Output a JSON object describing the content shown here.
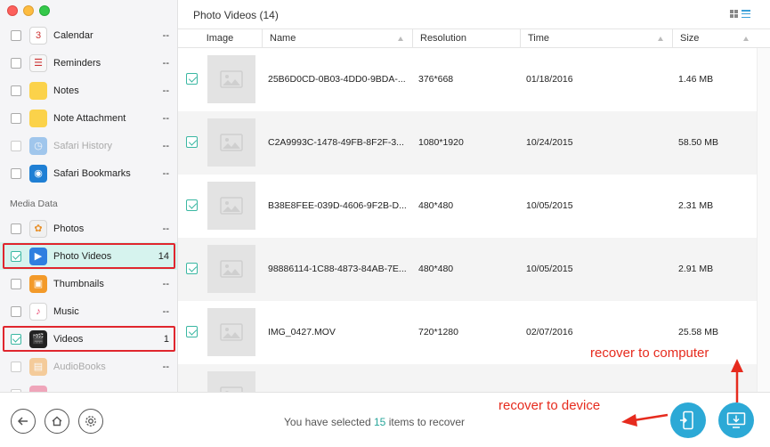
{
  "window": {
    "title": "Photo Videos (14)"
  },
  "sidebar": {
    "section_media": "Media Data",
    "items": [
      {
        "label": "Calendar",
        "count": "--",
        "icon": "calendar-icon",
        "glyph": "3",
        "color": "#ffffff",
        "checked": false,
        "disabled": false,
        "selected": false,
        "highlight": false
      },
      {
        "label": "Reminders",
        "count": "--",
        "icon": "reminders-icon",
        "glyph": "☰",
        "color": "#f7f7f7",
        "checked": false,
        "disabled": false,
        "selected": false,
        "highlight": false
      },
      {
        "label": "Notes",
        "count": "--",
        "icon": "notes-icon",
        "glyph": "",
        "color": "#fbd24a",
        "checked": false,
        "disabled": false,
        "selected": false,
        "highlight": false
      },
      {
        "label": "Note Attachment",
        "count": "--",
        "icon": "note-attachment-icon",
        "glyph": "",
        "color": "#fbd24a",
        "checked": false,
        "disabled": false,
        "selected": false,
        "highlight": false
      },
      {
        "label": "Safari History",
        "count": "--",
        "icon": "safari-history-icon",
        "glyph": "◷",
        "color": "#3b8fe0",
        "checked": false,
        "disabled": true,
        "selected": false,
        "highlight": false
      },
      {
        "label": "Safari Bookmarks",
        "count": "--",
        "icon": "safari-bookmarks-icon",
        "glyph": "◉",
        "color": "#1f7fd4",
        "checked": false,
        "disabled": false,
        "selected": false,
        "highlight": false
      },
      {
        "label": "Photos",
        "count": "--",
        "icon": "photos-icon",
        "glyph": "✿",
        "color": "#f0f0f0",
        "checked": false,
        "disabled": false,
        "selected": false,
        "highlight": false
      },
      {
        "label": "Photo Videos",
        "count": "14",
        "icon": "photo-videos-icon",
        "glyph": "▶",
        "color": "#2f7fe0",
        "checked": true,
        "disabled": false,
        "selected": true,
        "highlight": true
      },
      {
        "label": "Thumbnails",
        "count": "--",
        "icon": "thumbnails-icon",
        "glyph": "▣",
        "color": "#f39a2a",
        "checked": false,
        "disabled": false,
        "selected": false,
        "highlight": false
      },
      {
        "label": "Music",
        "count": "--",
        "icon": "music-icon",
        "glyph": "♪",
        "color": "#ffffff",
        "checked": false,
        "disabled": false,
        "selected": false,
        "highlight": false
      },
      {
        "label": "Videos",
        "count": "1",
        "icon": "videos-icon",
        "glyph": "🎬",
        "color": "#222222",
        "checked": true,
        "disabled": false,
        "selected": false,
        "highlight": true
      },
      {
        "label": "AudioBooks",
        "count": "--",
        "icon": "audiobooks-icon",
        "glyph": "▤",
        "color": "#f39a2a",
        "checked": false,
        "disabled": true,
        "selected": false,
        "highlight": false
      },
      {
        "label": "",
        "count": "",
        "icon": "books-icon",
        "glyph": "",
        "color": "#e8446e",
        "checked": false,
        "disabled": true,
        "selected": false,
        "highlight": false
      }
    ]
  },
  "table": {
    "columns": [
      "Image",
      "Name",
      "Resolution",
      "Time",
      "Size"
    ],
    "rows": [
      {
        "name": "25B6D0CD-0B03-4DD0-9BDA-...",
        "resolution": "376*668",
        "time": "01/18/2016",
        "size": "1.46 MB"
      },
      {
        "name": "C2A9993C-1478-49FB-8F2F-3...",
        "resolution": "1080*1920",
        "time": "10/24/2015",
        "size": "58.50 MB"
      },
      {
        "name": "B38E8FEE-039D-4606-9F2B-D...",
        "resolution": "480*480",
        "time": "10/05/2015",
        "size": "2.31 MB"
      },
      {
        "name": "98886114-1C88-4873-84AB-7E...",
        "resolution": "480*480",
        "time": "10/05/2015",
        "size": "2.91 MB"
      },
      {
        "name": "IMG_0427.MOV",
        "resolution": "720*1280",
        "time": "02/07/2016",
        "size": "25.58 MB"
      },
      {
        "name": "",
        "resolution": "",
        "time": "",
        "size": ""
      }
    ]
  },
  "footer": {
    "status_prefix": "You have selected",
    "selected_count": "15",
    "status_suffix": "items to recover"
  },
  "annotations": {
    "to_computer": "recover to computer",
    "to_device": "recover to device"
  },
  "colors": {
    "accent": "#2ca9d6",
    "check": "#3ab7a2",
    "highlight": "#e0262e",
    "annotation": "#e62b1e"
  }
}
